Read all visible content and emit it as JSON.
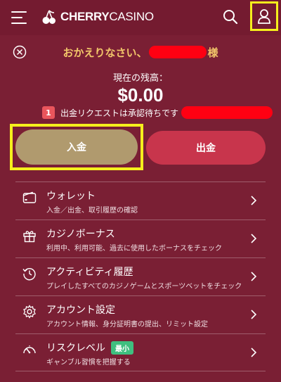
{
  "header": {
    "logo_bold": "CHERRY",
    "logo_light": "CASINO",
    "icons": [
      "hamburger-menu-icon",
      "cherry-logo-icon",
      "search-icon",
      "user-icon"
    ]
  },
  "account": {
    "welcome_prefix": "おかえりなさい、",
    "welcome_suffix": "様",
    "balance_label": "現在の残高：",
    "balance_value": "$0.00",
    "pending_count": "1",
    "pending_text": "出金リクエストは承認待ちです"
  },
  "actions": {
    "deposit_label": "入金",
    "withdraw_label": "出金"
  },
  "menu": {
    "items": [
      {
        "title": "ウォレット",
        "sub": "入金／出金、取引履歴の確認",
        "icon": "wallet-icon"
      },
      {
        "title": "カジノボーナス",
        "sub": "利用中、利用可能、過去に使用したボーナスをチェック",
        "icon": "gift-icon"
      },
      {
        "title": "アクティビティ履歴",
        "sub": "プレイしたすべてのカジノゲームとスポーツベットをチェック",
        "icon": "history-icon"
      },
      {
        "title": "アカウント設定",
        "sub": "アカウント情報、身分証明書の提出、リミット設定",
        "icon": "gear-icon"
      },
      {
        "title": "リスクレベル",
        "sub": "ギャンブル習慣を把握する",
        "icon": "gauge-icon",
        "badge": "最小"
      }
    ]
  },
  "colors": {
    "background": "#7a1f34",
    "welcome_gold": "#f2c66a",
    "deposit": "#b09a6e",
    "withdraw": "#c8354c",
    "risk_badge": "#3fbf7f",
    "highlight": "#f5ef1c",
    "redaction": "#ff0012"
  }
}
